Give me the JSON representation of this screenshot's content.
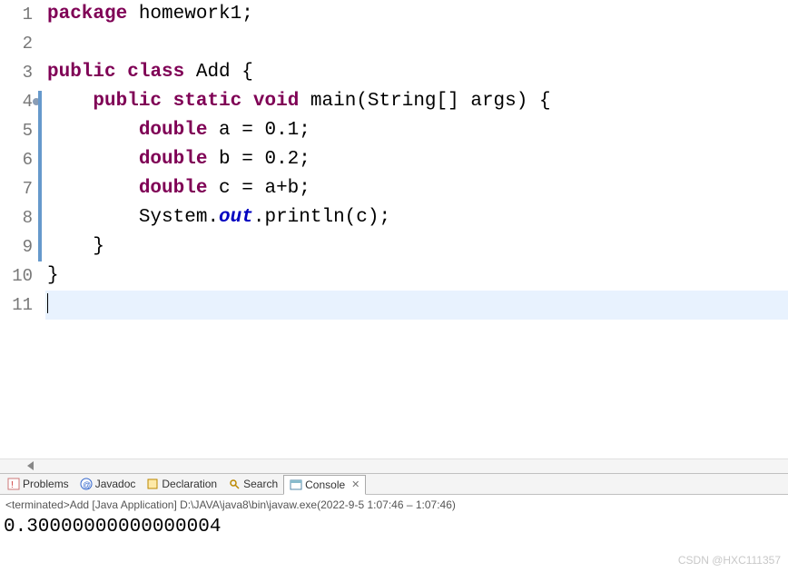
{
  "code": {
    "lines": [
      {
        "n": "1"
      },
      {
        "n": "2"
      },
      {
        "n": "3"
      },
      {
        "n": "4",
        "marked": true
      },
      {
        "n": "5"
      },
      {
        "n": "6"
      },
      {
        "n": "7"
      },
      {
        "n": "8"
      },
      {
        "n": "9"
      },
      {
        "n": "10"
      },
      {
        "n": "11"
      }
    ],
    "kw_package": "package",
    "pkg_name": " homework1;",
    "kw_public": "public",
    "kw_class": "class",
    "class_name": " Add {",
    "kw_static": "static",
    "kw_void": "void",
    "main_sig": " main(String[] args) {",
    "kw_double": "double",
    "decl_a": " a = 0.1;",
    "decl_b": " b = 0.2;",
    "decl_c": " c = a+b;",
    "sys": "System.",
    "out": "out",
    "println": ".println(c);",
    "close_brace_inner": "    }",
    "close_brace_outer": "}"
  },
  "tabs": {
    "problems": "Problems",
    "javadoc": "Javadoc",
    "declaration": "Declaration",
    "search": "Search",
    "console": "Console"
  },
  "status": {
    "terminated": "<terminated>",
    "run_config": " Add [Java Application] D:\\JAVA\\java8\\bin\\javaw.exe ",
    "timestamp": "(2022-9-5 1:07:46 – 1:07:46)"
  },
  "console": {
    "output": "0.30000000000000004"
  },
  "watermark": "CSDN @HXC111357"
}
